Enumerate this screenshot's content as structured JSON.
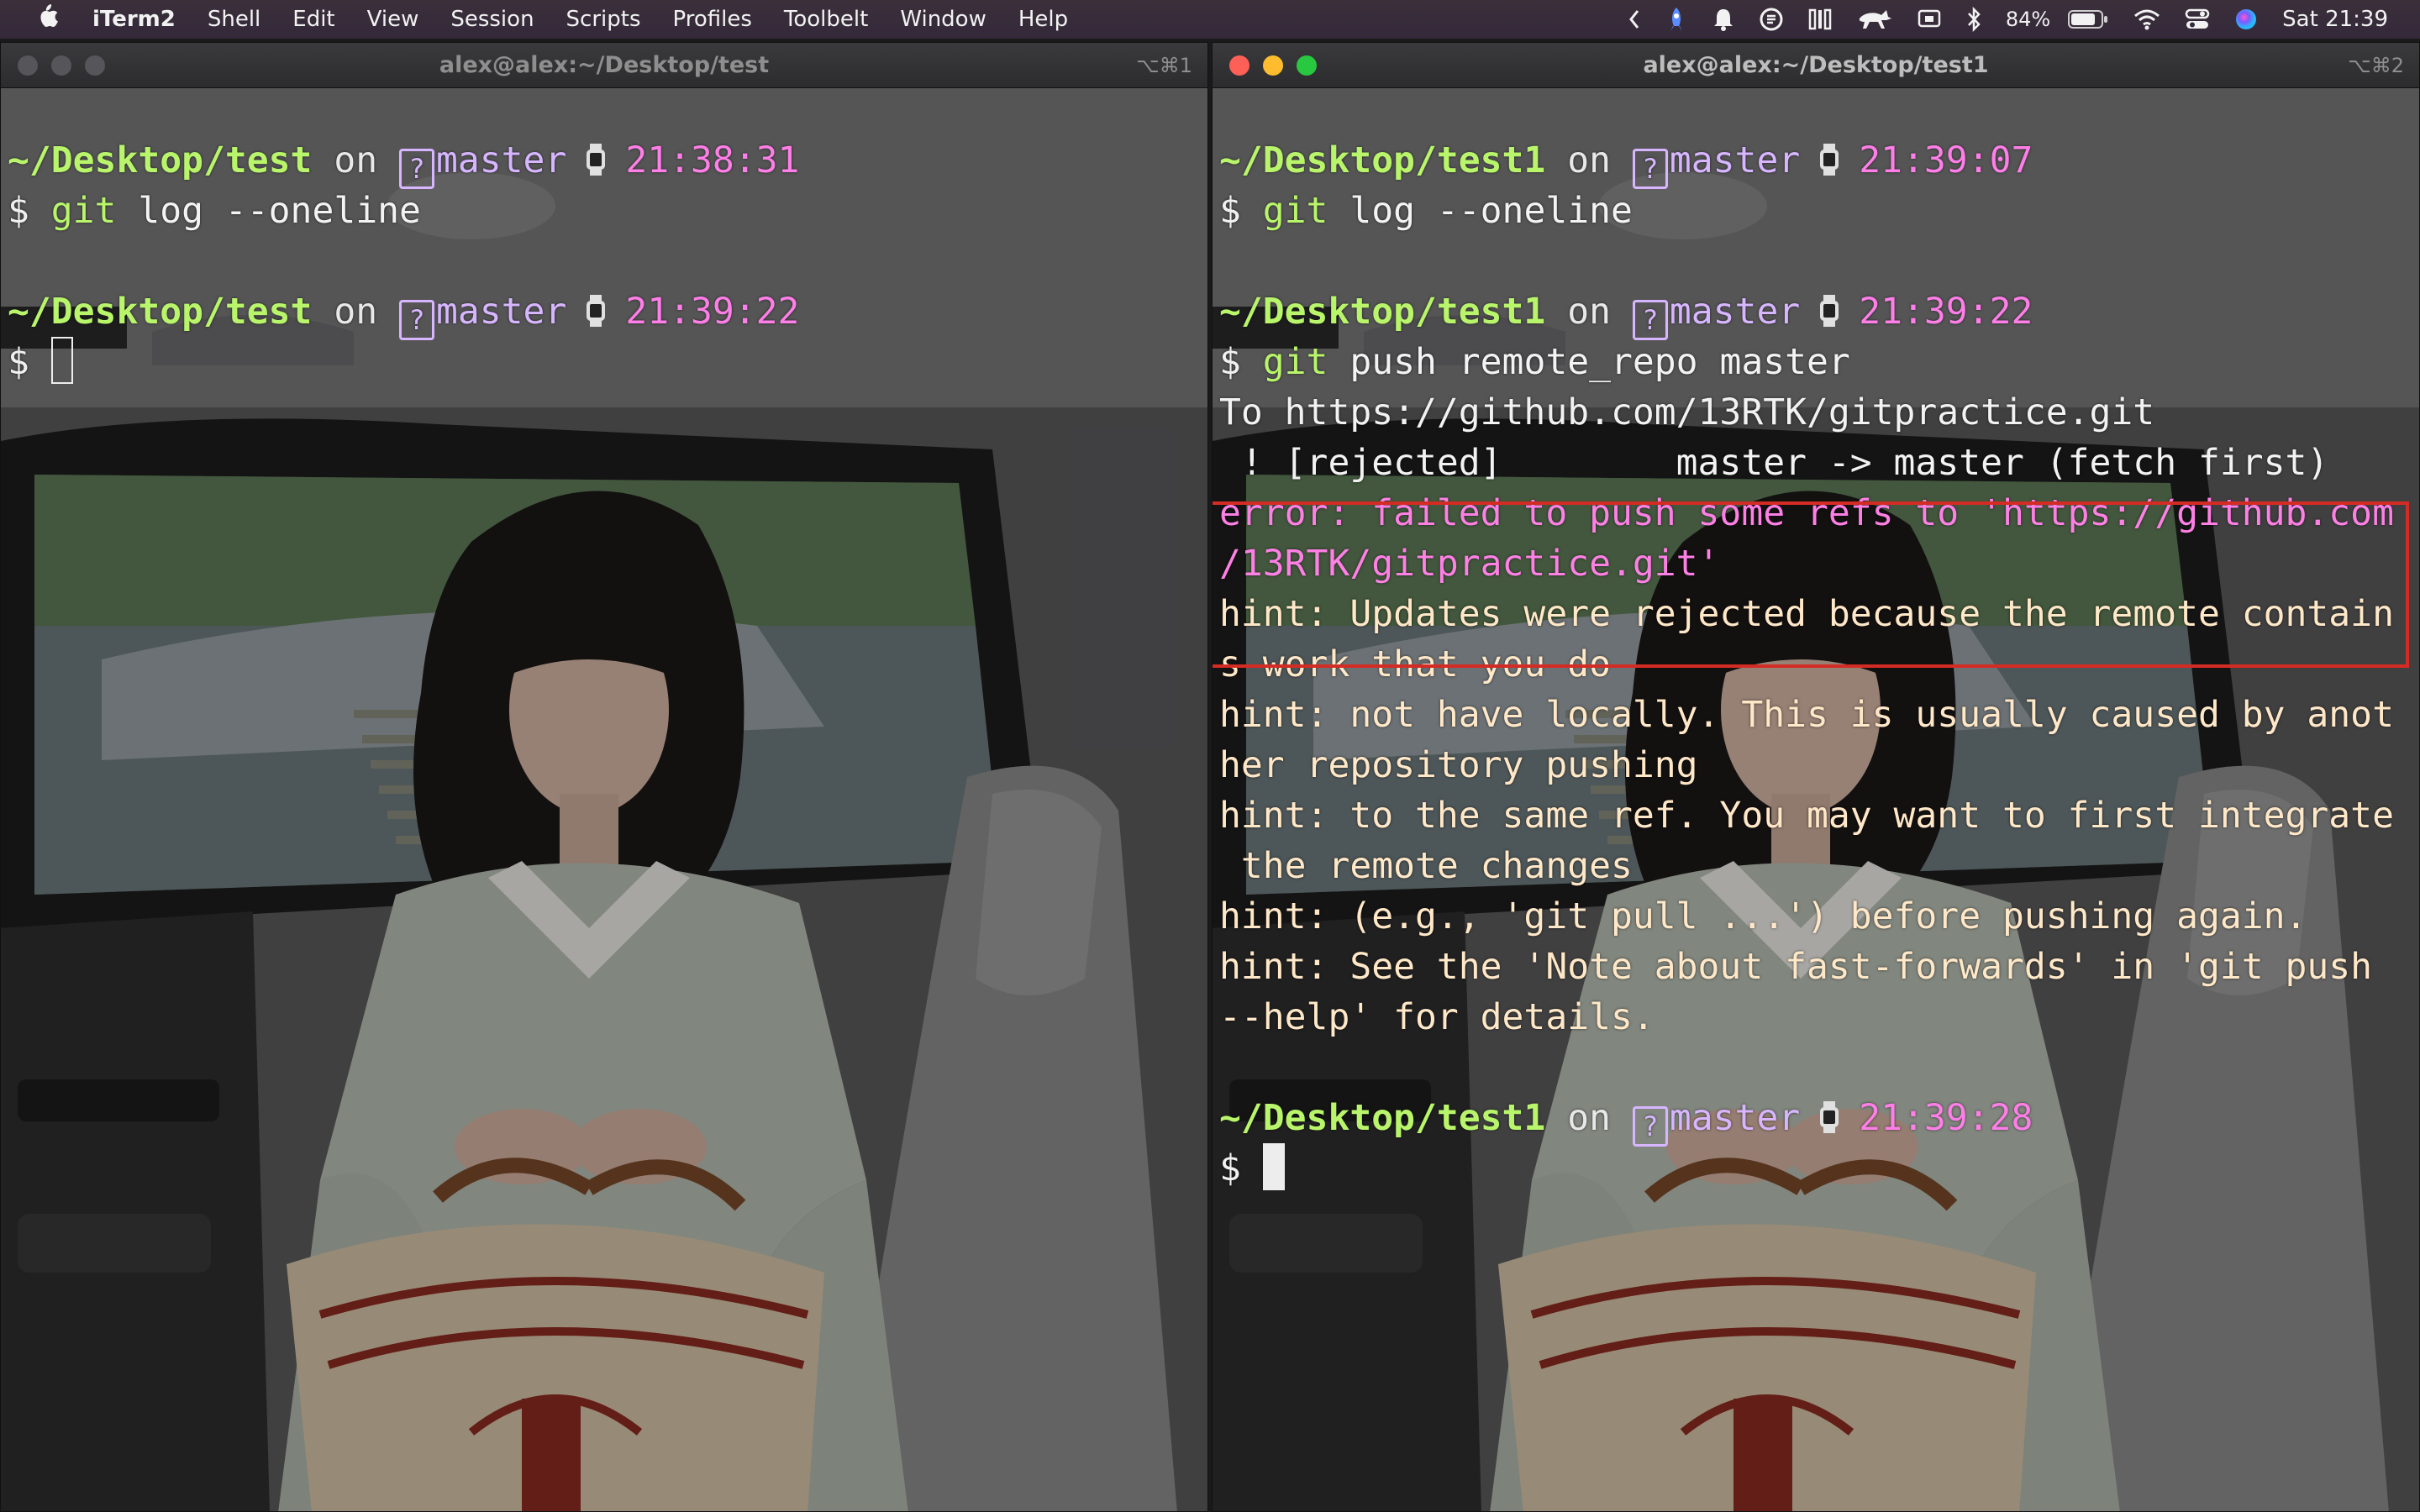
{
  "menubar": {
    "app_name": "iTerm2",
    "menus": [
      "Shell",
      "Edit",
      "View",
      "Session",
      "Scripts",
      "Profiles",
      "Toolbelt",
      "Window",
      "Help"
    ],
    "status": {
      "battery_percent": "84%",
      "clock": "Sat 21:39"
    }
  },
  "left_window": {
    "title": "alex@alex:~/Desktop/test",
    "shortcut": "⌥⌘1",
    "prompt_1": {
      "path": "~/Desktop/test",
      "on": "on",
      "git_symbol": "?",
      "branch": "master",
      "time": "21:38:31"
    },
    "command_1": {
      "dollar": "$",
      "git": "git",
      "rest": " log --oneline"
    },
    "prompt_2": {
      "path": "~/Desktop/test",
      "on": "on",
      "git_symbol": "?",
      "branch": "master",
      "time": "21:39:22"
    },
    "command_2": {
      "dollar": "$"
    }
  },
  "right_window": {
    "title": "alex@alex:~/Desktop/test1",
    "shortcut": "⌥⌘2",
    "prompt_1": {
      "path": "~/Desktop/test1",
      "on": "on",
      "git_symbol": "?",
      "branch": "master",
      "time": "21:39:07"
    },
    "command_1": {
      "dollar": "$",
      "git": "git",
      "rest": " log --oneline"
    },
    "prompt_2": {
      "path": "~/Desktop/test1",
      "on": "on",
      "git_symbol": "?",
      "branch": "master",
      "time": "21:39:22"
    },
    "command_2": {
      "dollar": "$",
      "git": "git",
      "rest": " push remote_repo master"
    },
    "output": [
      {
        "kind": "out",
        "text": "To https://github.com/13RTK/gitpractice.git"
      },
      {
        "kind": "out",
        "text": " ! [rejected]        master -> master (fetch first)"
      },
      {
        "kind": "err",
        "text": "error: failed to push some refs to 'https://github.com"
      },
      {
        "kind": "err",
        "text": "/13RTK/gitpractice.git'"
      },
      {
        "kind": "hint",
        "text": "hint: Updates were rejected because the remote contain"
      },
      {
        "kind": "hint",
        "text": "s work that you do"
      },
      {
        "kind": "hint",
        "text": "hint: not have locally. This is usually caused by anot"
      },
      {
        "kind": "hint",
        "text": "her repository pushing"
      },
      {
        "kind": "hint",
        "text": "hint: to the same ref. You may want to first integrate"
      },
      {
        "kind": "hint",
        "text": " the remote changes"
      },
      {
        "kind": "hint",
        "text": "hint: (e.g., 'git pull ...') before pushing again."
      },
      {
        "kind": "hint",
        "text": "hint: See the 'Note about fast-forwards' in 'git push"
      },
      {
        "kind": "hint",
        "text": "--help' for details."
      }
    ],
    "prompt_3": {
      "path": "~/Desktop/test1",
      "on": "on",
      "git_symbol": "?",
      "branch": "master",
      "time": "21:39:28"
    },
    "command_3": {
      "dollar": "$"
    }
  },
  "colors": {
    "path": "#b9f56b",
    "branch": "#d7b6ff",
    "time": "#ff7ee8",
    "error": "#ff80e5",
    "hint": "#ffe8c8",
    "highlight_box": "#d42c24"
  }
}
